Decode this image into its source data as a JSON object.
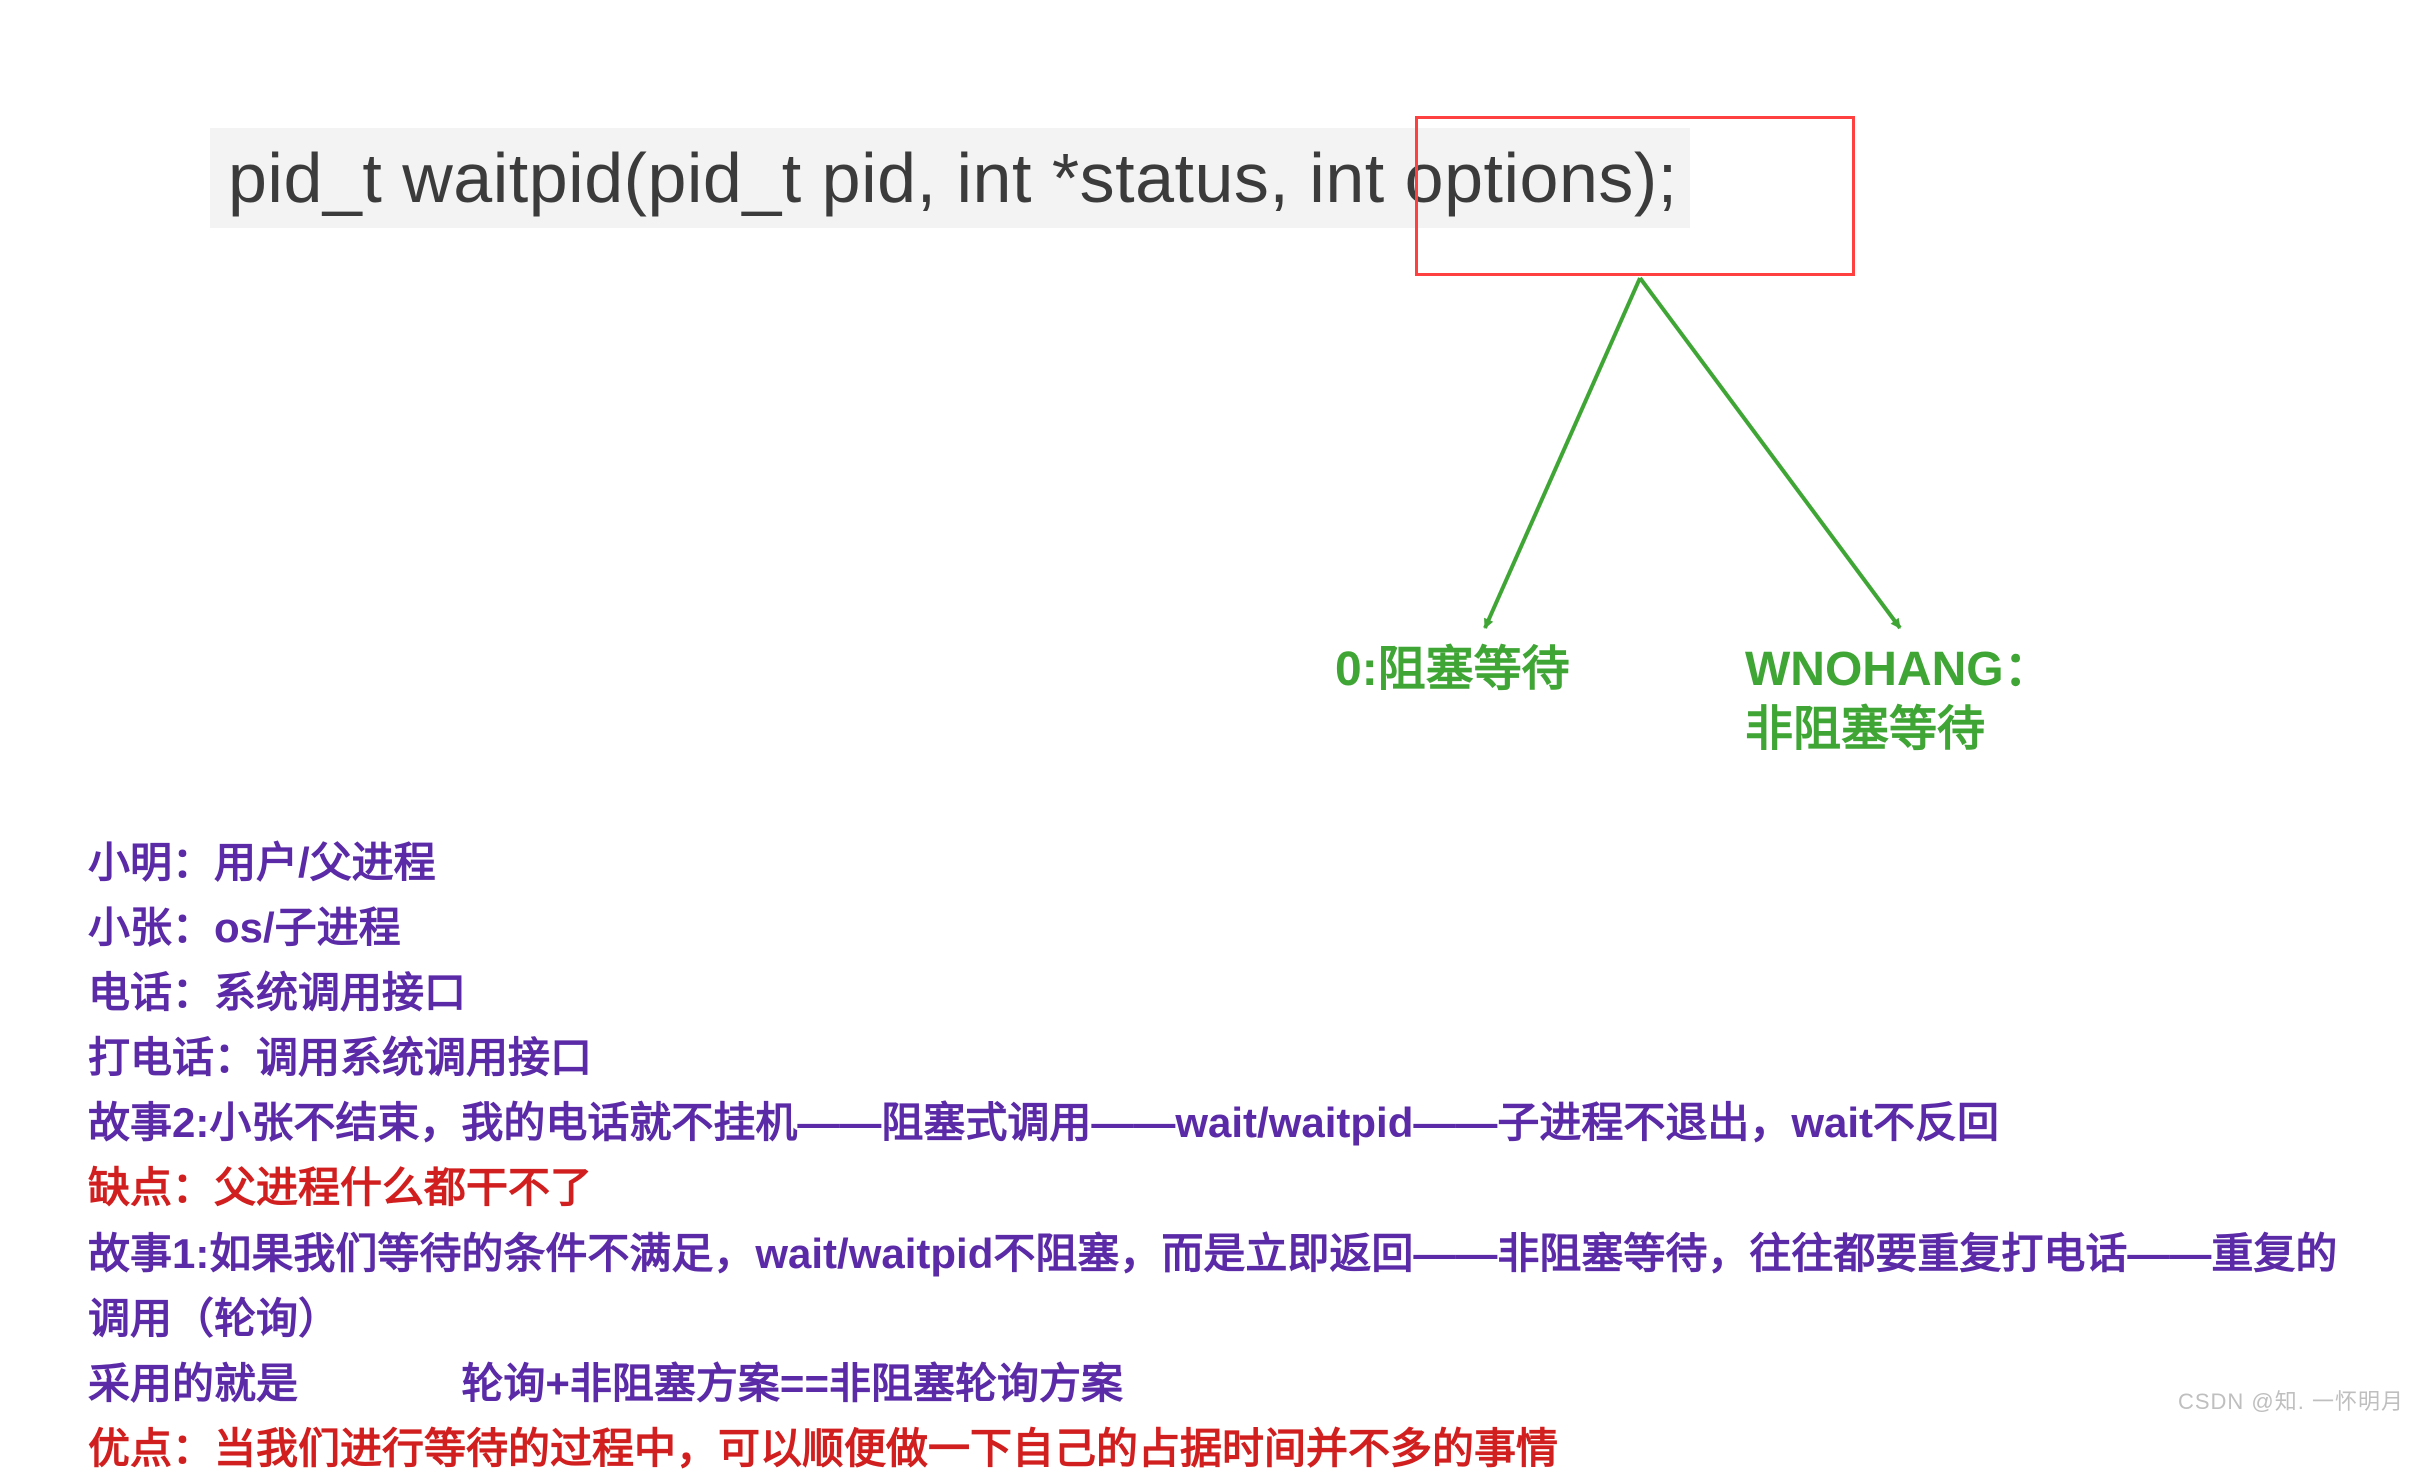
{
  "code": {
    "signature": "pid_t waitpid(pid_t pid, int *status, int options);"
  },
  "arrows": {
    "leftLabel": "0:阻塞等待",
    "rightLabel1": "WNOHANG：",
    "rightLabel2": "非阻塞等待"
  },
  "notes": {
    "l1": "小明：用户/父进程",
    "l2": "小张：os/子进程",
    "l3": "电话：系统调用接口",
    "l4": "打电话：调用系统调用接口",
    "l5": "故事2:小张不结束，我的电话就不挂机——阻塞式调用——wait/waitpid——子进程不退出，wait不反回",
    "l6": "缺点：父进程什么都干不了",
    "l7": "故事1:如果我们等待的条件不满足，wait/waitpid不阻塞，而是立即返回——非阻塞等待，往往都要重复打电话——重复的调用（轮询）",
    "l8a": "采用的就是",
    "l8b": "轮询+非阻塞方案==非阻塞轮询方案",
    "l9": "优点：当我们进行等待的过程中，可以顺便做一下自己的占据时间并不多的事情"
  },
  "watermark": "CSDN @知. 一怀明月"
}
